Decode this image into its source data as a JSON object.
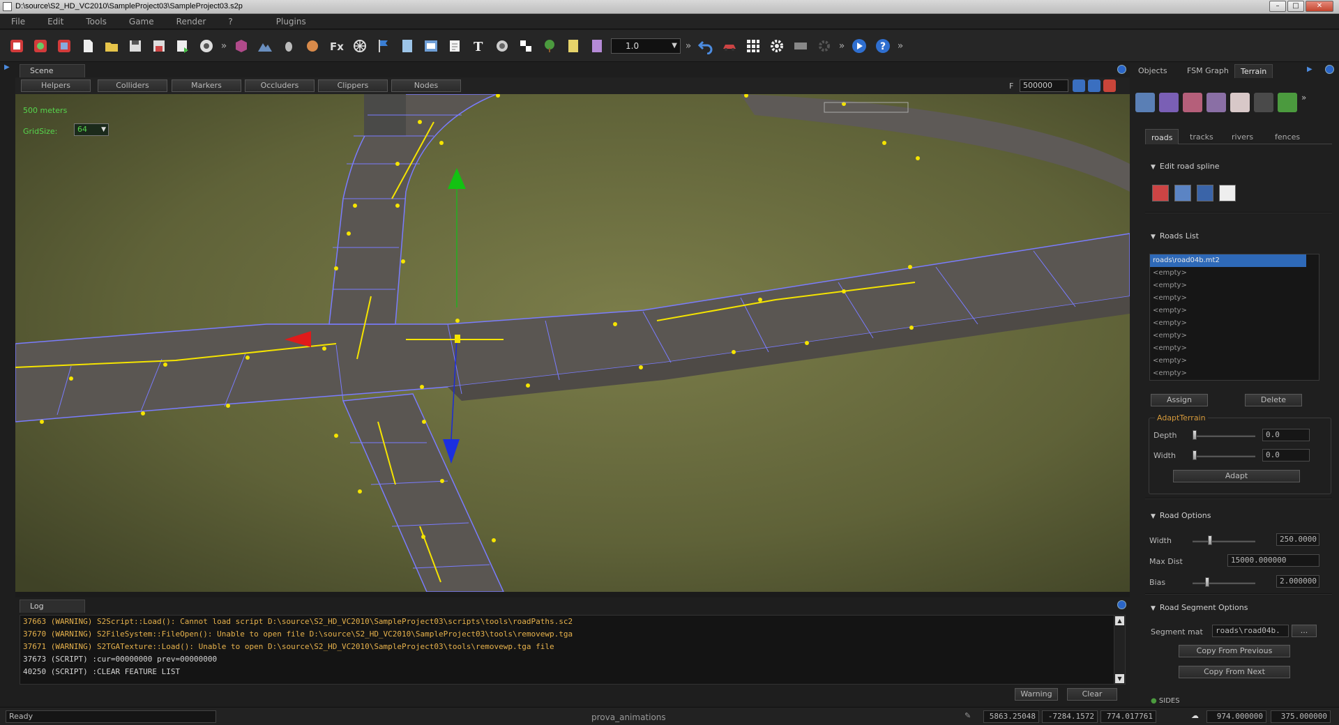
{
  "window": {
    "title": "D:\\source\\S2_HD_VC2010\\SampleProject03\\SampleProject03.s2p",
    "min": "–",
    "max": "□",
    "close": "✕"
  },
  "menu": [
    "File",
    "Edit",
    "Tools",
    "Game",
    "Render",
    "?",
    "Plugins"
  ],
  "toolbar": {
    "zoom_combo": "1.0",
    "overflow": "»"
  },
  "scene": {
    "tab_label": "Scene",
    "filters": [
      "Helpers",
      "Colliders",
      "Markers",
      "Occluders",
      "Clippers",
      "Nodes"
    ],
    "far_label": "F",
    "far_value": "500000",
    "scale_label": "500 meters",
    "gridsize_label": "GridSize:",
    "gridsize_value": "64"
  },
  "log": {
    "tab_label": "Log",
    "lines": [
      {
        "text": "37663 (WARNING) S2Script::Load(): Cannot load script D:\\source\\S2_HD_VC2010\\SampleProject03\\scripts\\tools\\roadPaths.sc2",
        "level": "warn"
      },
      {
        "text": "37670 (WARNING) S2FileSystem::FileOpen(): Unable to open file D:\\source\\S2_HD_VC2010\\SampleProject03\\tools\\removewp.tga",
        "level": "warn"
      },
      {
        "text": "37671 (WARNING) S2TGATexture::Load(): Unable to open D:\\source\\S2_HD_VC2010\\SampleProject03\\tools\\removewp.tga file",
        "level": "warn"
      },
      {
        "text": "37673 (SCRIPT) :cur=00000000 prev=00000000",
        "level": "info"
      },
      {
        "text": "40250 (SCRIPT) :CLEAR FEATURE LIST",
        "level": "info"
      }
    ],
    "warning_button": "Warning",
    "clear_button": "Clear"
  },
  "status": {
    "ready": "Ready",
    "project": "prova_animations",
    "x": "5863.25048",
    "y": "-7284.1572",
    "z": "774.017761",
    "v1": "974.000000",
    "v2": "375.000000"
  },
  "right_panel": {
    "tabs": [
      "Objects",
      "FSM Graph",
      "Terrain"
    ],
    "active_tab": "Terrain",
    "subtabs": [
      "roads",
      "tracks",
      "rivers",
      "fences"
    ],
    "active_subtab": "roads",
    "edit_spline_header": "Edit road spline",
    "roads_list_header": "Roads List",
    "roads": [
      "roads\\road04b.mt2",
      "<empty>",
      "<empty>",
      "<empty>",
      "<empty>",
      "<empty>",
      "<empty>",
      "<empty>",
      "<empty>",
      "<empty>"
    ],
    "assign_button": "Assign",
    "delete_button": "Delete",
    "adapt_terrain_title": "AdaptTerrain",
    "depth_label": "Depth",
    "depth_value": "0.0",
    "adapt_width_label": "Width",
    "adapt_width_value": "0.0",
    "adapt_button": "Adapt",
    "road_options_header": "Road Options",
    "width_label": "Width",
    "width_value": "250.0000",
    "maxdist_label": "Max Dist",
    "maxdist_value": "15000.000000",
    "bias_label": "Bias",
    "bias_value": "2.000000",
    "segment_header": "Road Segment Options",
    "segment_mat_label": "Segment mat",
    "segment_mat_value": "roads\\road04b.",
    "browse_button": "...",
    "copy_prev_button": "Copy From Previous",
    "copy_next_button": "Copy From Next",
    "sides_label": "SIDES"
  },
  "colors": {
    "warning_text": "#e7b24c",
    "grid_label": "#56d64d",
    "selection": "#2e69b8",
    "spline_yellow": "#f5e400",
    "wire_blue": "#7a7cff"
  }
}
